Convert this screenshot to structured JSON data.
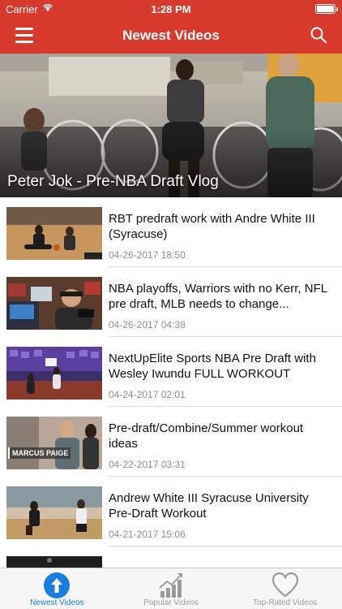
{
  "status_bar": {
    "carrier": "Carrier",
    "time": "1:28 PM"
  },
  "nav": {
    "title": "Newest Videos",
    "menu_icon": "hamburger-menu-icon",
    "search_icon": "search-icon"
  },
  "featured": {
    "title": "Peter Jok - Pre-NBA Draft Vlog"
  },
  "videos": [
    {
      "title": "RBT predraft work with Andre White III (Syracuse)",
      "date": "04-26-2017 18:50"
    },
    {
      "title": "NBA playoffs, Warriors with no Kerr, NFL pre draft, MLB needs to change...",
      "date": "04-26-2017 04:38"
    },
    {
      "title": "NextUpElite Sports NBA Pre Draft with Wesley Iwundu FULL WORKOUT",
      "date": "04-24-2017 02:01"
    },
    {
      "title": "Pre-draft/Combine/Summer workout ideas",
      "date": "04-22-2017 03:31",
      "thumb_caption": "MARCUS PAIGE"
    },
    {
      "title": "Andrew White III Syracuse University Pre-Draft Workout",
      "date": "04-21-2017 15:06"
    }
  ],
  "tabs": [
    {
      "label": "Newest Videos",
      "icon": "arrow-up-circle-icon",
      "active": true
    },
    {
      "label": "Popular Videos",
      "icon": "chart-trend-icon",
      "active": false
    },
    {
      "label": "Top-Rated Videos",
      "icon": "heart-icon",
      "active": false
    }
  ],
  "colors": {
    "accent_red": "#d8392d",
    "tab_active_blue": "#1a7ee0",
    "tab_inactive_gray": "#9b9b9b"
  }
}
